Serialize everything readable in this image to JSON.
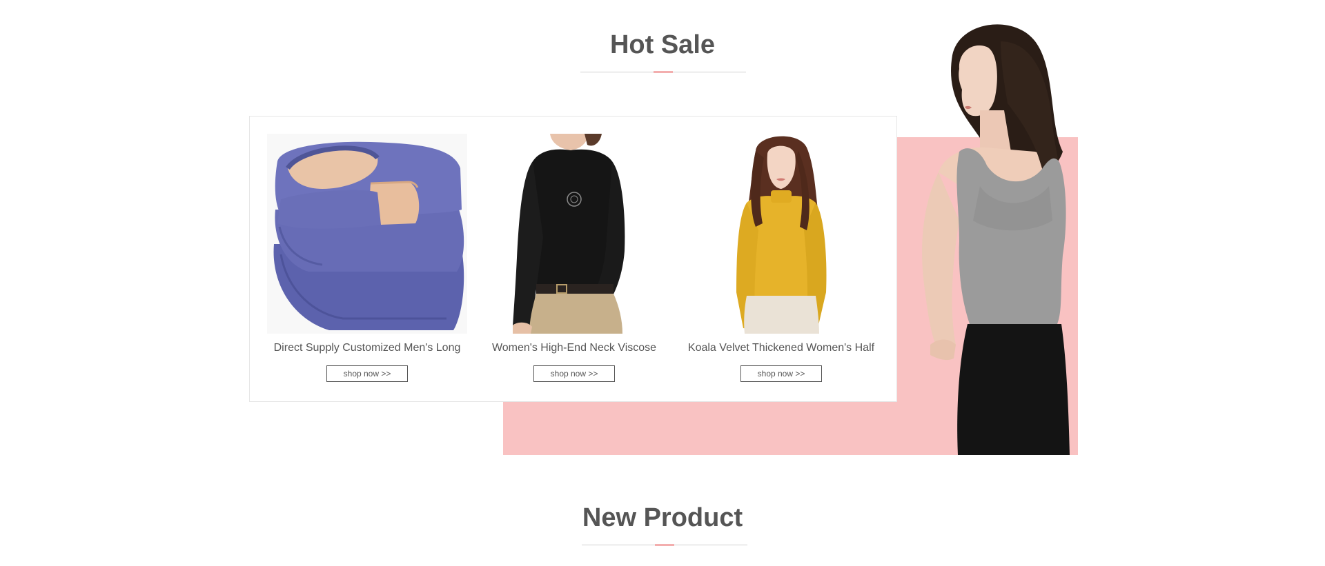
{
  "sections": {
    "hot_sale_title": "Hot Sale",
    "new_product_title": "New Product"
  },
  "colors": {
    "accent_pink": "#f9c2c2",
    "title_text": "#555555"
  },
  "hot_sale": {
    "products": [
      {
        "name": "Direct Supply Customized Men's Long",
        "button": "shop now >>",
        "image": "folded-blue-thermal-shirt"
      },
      {
        "name": "Women's High-End Neck Viscose",
        "button": "shop now >>",
        "image": "black-long-sleeve-top"
      },
      {
        "name": "Koala Velvet Thickened Women's Half",
        "button": "shop now >>",
        "image": "yellow-turtleneck-top"
      }
    ],
    "banner_image": "woman-in-grey-tank-top"
  }
}
